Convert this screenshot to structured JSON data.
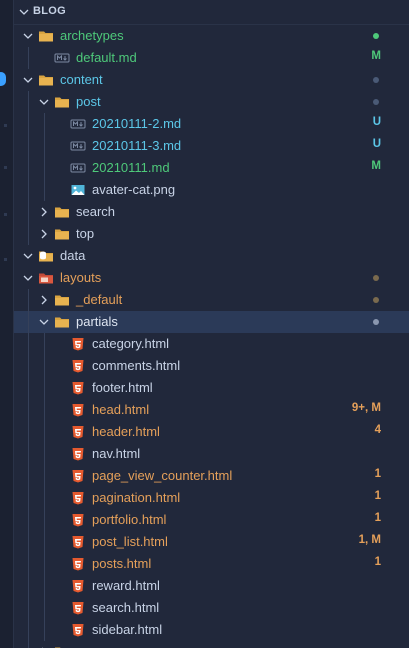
{
  "colors": {
    "background": "#21283b",
    "selected_row": "#2b3a58",
    "added": "#4ec97a",
    "modified_green": "#4ec97a",
    "untracked": "#5cc7e8",
    "orange": "#e5a05a",
    "default_text": "#c8d3e6",
    "folder": "#d9a441",
    "html_icon": "#e55a2f"
  },
  "explorer": {
    "section_title": "BLOG",
    "items": [
      {
        "label": "archetypes",
        "type": "folder",
        "expanded": true,
        "depth": 0,
        "color": "#4ec97a",
        "dot": "#4ec97a",
        "status": ""
      },
      {
        "label": "default.md",
        "type": "md",
        "depth": 1,
        "color": "#4ec97a",
        "status": "M",
        "status_color": "#4ec97a"
      },
      {
        "label": "content",
        "type": "folder",
        "expanded": true,
        "depth": 0,
        "color": "#5cc7e8",
        "dot": "#4a5a76",
        "status": ""
      },
      {
        "label": "post",
        "type": "folder",
        "expanded": true,
        "depth": 1,
        "color": "#5cc7e8",
        "dot": "#4a5a76",
        "status": ""
      },
      {
        "label": "20210111-2.md",
        "type": "md",
        "depth": 2,
        "color": "#5cc7e8",
        "status": "U",
        "status_color": "#5cc7e8"
      },
      {
        "label": "20210111-3.md",
        "type": "md",
        "depth": 2,
        "color": "#5cc7e8",
        "status": "U",
        "status_color": "#5cc7e8"
      },
      {
        "label": "20210111.md",
        "type": "md",
        "depth": 2,
        "color": "#4ec97a",
        "status": "M",
        "status_color": "#4ec97a"
      },
      {
        "label": "avater-cat.png",
        "type": "image",
        "depth": 2,
        "color": "#c8d3e6",
        "status": ""
      },
      {
        "label": "search",
        "type": "folder",
        "expanded": false,
        "depth": 1,
        "color": "#c8d3e6",
        "status": ""
      },
      {
        "label": "top",
        "type": "folder",
        "expanded": false,
        "depth": 1,
        "color": "#c8d3e6",
        "status": ""
      },
      {
        "label": "data",
        "type": "folder-special",
        "expanded": true,
        "depth": 0,
        "color": "#c8d3e6",
        "status": ""
      },
      {
        "label": "layouts",
        "type": "folder-layouts",
        "expanded": true,
        "depth": 0,
        "color": "#e5a05a",
        "dot": "#7a6a4e",
        "status": ""
      },
      {
        "label": "_default",
        "type": "folder",
        "expanded": false,
        "depth": 1,
        "color": "#e5a05a",
        "dot": "#7a6a4e",
        "status": ""
      },
      {
        "label": "partials",
        "type": "folder",
        "expanded": true,
        "depth": 1,
        "color": "#dfe6f2",
        "dot": "#8a97b0",
        "status": "",
        "selected": true
      },
      {
        "label": "category.html",
        "type": "html",
        "depth": 2,
        "color": "#c8d3e6",
        "status": ""
      },
      {
        "label": "comments.html",
        "type": "html",
        "depth": 2,
        "color": "#c8d3e6",
        "status": ""
      },
      {
        "label": "footer.html",
        "type": "html",
        "depth": 2,
        "color": "#c8d3e6",
        "status": ""
      },
      {
        "label": "head.html",
        "type": "html",
        "depth": 2,
        "color": "#e5a05a",
        "status": "9+, M",
        "status_color": "#e5a05a"
      },
      {
        "label": "header.html",
        "type": "html",
        "depth": 2,
        "color": "#e5a05a",
        "status": "4",
        "status_color": "#e5a05a"
      },
      {
        "label": "nav.html",
        "type": "html",
        "depth": 2,
        "color": "#c8d3e6",
        "status": ""
      },
      {
        "label": "page_view_counter.html",
        "type": "html",
        "depth": 2,
        "color": "#e5a05a",
        "status": "1",
        "status_color": "#e5a05a"
      },
      {
        "label": "pagination.html",
        "type": "html",
        "depth": 2,
        "color": "#e5a05a",
        "status": "1",
        "status_color": "#e5a05a"
      },
      {
        "label": "portfolio.html",
        "type": "html",
        "depth": 2,
        "color": "#e5a05a",
        "status": "1",
        "status_color": "#e5a05a"
      },
      {
        "label": "post_list.html",
        "type": "html",
        "depth": 2,
        "color": "#e5a05a",
        "status": "1, M",
        "status_color": "#e5a05a"
      },
      {
        "label": "posts.html",
        "type": "html",
        "depth": 2,
        "color": "#e5a05a",
        "status": "1",
        "status_color": "#e5a05a"
      },
      {
        "label": "reward.html",
        "type": "html",
        "depth": 2,
        "color": "#c8d3e6",
        "status": ""
      },
      {
        "label": "search.html",
        "type": "html",
        "depth": 2,
        "color": "#c8d3e6",
        "status": ""
      },
      {
        "label": "sidebar.html",
        "type": "html",
        "depth": 2,
        "color": "#c8d3e6",
        "status": ""
      },
      {
        "label": "",
        "type": "folder",
        "expanded": false,
        "depth": 1,
        "color": "#c8d3e6",
        "status": ""
      }
    ]
  }
}
